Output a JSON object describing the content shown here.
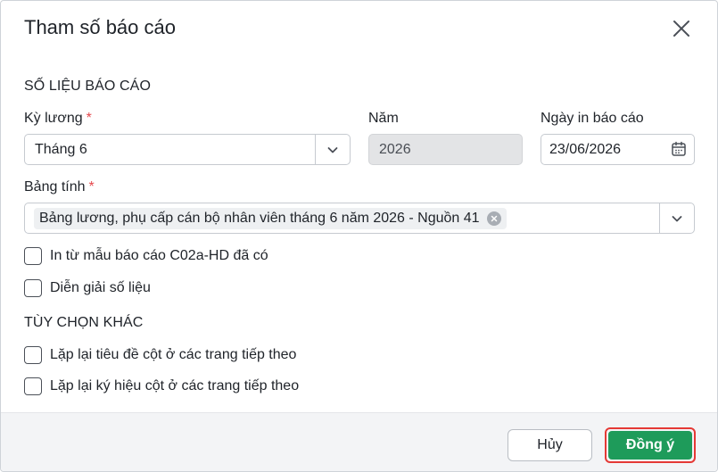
{
  "dialog": {
    "title": "Tham số báo cáo"
  },
  "section_data": {
    "heading": "SỐ LIỆU BÁO CÁO",
    "period": {
      "label": "Kỳ lương",
      "required_mark": "*",
      "value": "Tháng 6"
    },
    "year": {
      "label": "Năm",
      "value": "2026"
    },
    "print_date": {
      "label": "Ngày in báo cáo",
      "value": "23/06/2026"
    },
    "sheet": {
      "label": "Bảng tính",
      "required_mark": "*",
      "selected": [
        "Bảng lương, phụ cấp cán bộ nhân viên tháng 6 năm 2026 - Nguồn 41"
      ]
    },
    "options": [
      {
        "label": "In từ mẫu báo cáo C02a-HD đã có",
        "checked": false
      },
      {
        "label": "Diễn giải số liệu",
        "checked": false
      }
    ]
  },
  "section_other": {
    "heading": "TÙY CHỌN KHÁC",
    "options": [
      {
        "label": "Lặp lại tiêu đề cột ở các trang tiếp theo",
        "checked": false
      },
      {
        "label": "Lặp lại ký hiệu cột ở các trang tiếp theo",
        "checked": false
      }
    ]
  },
  "footer": {
    "cancel_label": "Hủy",
    "ok_label": "Đồng ý"
  },
  "colors": {
    "primary": "#1e9b5a",
    "highlight": "#e53935",
    "required": "#e5484d"
  }
}
